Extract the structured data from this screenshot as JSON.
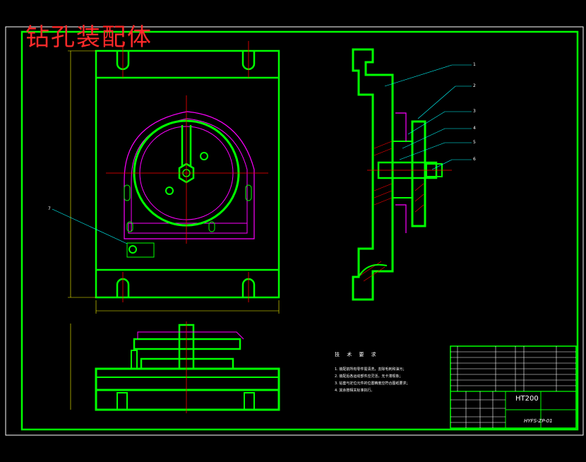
{
  "drawing": {
    "title": "钻孔装配体",
    "tech_requirements": {
      "title": "技 术 要 求",
      "notes": [
        "1. 装配前所有零件需清洗，去除毛刺和油污；",
        "2. 装配后各运动部件应灵活，无卡滞现象；",
        "3. 钻套与定位元件的位置精度应符合图纸要求；",
        "4. 其余按相关标准执行。"
      ]
    },
    "title_block": {
      "material": "HT200",
      "drawing_number": "HYFS-ZP-01"
    },
    "callouts": [
      "1",
      "2",
      "3",
      "4",
      "5",
      "6",
      "7"
    ]
  },
  "colors": {
    "outline": "#00ff00",
    "centerline": "#ff0000",
    "hidden": "#ff00ff",
    "dimension": "#ffff00",
    "leader": "#00ffff",
    "text": "#ffffff",
    "frame": "#ffffff"
  }
}
